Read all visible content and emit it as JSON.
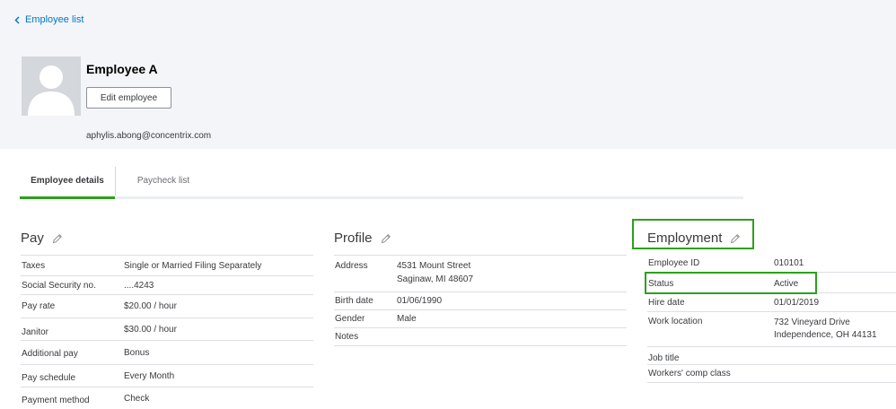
{
  "nav": {
    "back_label": "Employee list"
  },
  "employee": {
    "name": "Employee A",
    "edit_label": "Edit employee",
    "email": "aphylis.abong@concentrix.com"
  },
  "tabs": [
    {
      "label": "Employee details",
      "active": true
    },
    {
      "label": "Paycheck list",
      "active": false
    }
  ],
  "pay": {
    "title": "Pay",
    "rows": [
      {
        "label": "Taxes",
        "value": "Single or Married Filing Separately"
      },
      {
        "label": "Social Security no.",
        "value": "....4243"
      },
      {
        "label": "Pay rate",
        "value": "$20.00 / hour"
      },
      {
        "label": "Janitor",
        "value": "$30.00 / hour"
      },
      {
        "label": "Additional pay",
        "value": "Bonus"
      },
      {
        "label": "Pay schedule",
        "value": "Every Month"
      },
      {
        "label": "Payment method",
        "value": "Check"
      }
    ]
  },
  "profile": {
    "title": "Profile",
    "rows": [
      {
        "label": "Address",
        "value_line1": "4531 Mount Street",
        "value_line2": "Saginaw, MI 48607"
      },
      {
        "label": "Birth date",
        "value": "01/06/1990"
      },
      {
        "label": "Gender",
        "value": "Male"
      },
      {
        "label": "Notes",
        "value": ""
      }
    ]
  },
  "employment": {
    "title": "Employment",
    "rows": [
      {
        "label": "Employee ID",
        "value": "010101"
      },
      {
        "label": "Status",
        "value": "Active"
      },
      {
        "label": "Hire date",
        "value": "01/01/2019"
      },
      {
        "label": "Work location",
        "value_line1": "732 Vineyard Drive",
        "value_line2": "Independence, OH 44131"
      },
      {
        "label": "Job title",
        "value": ""
      },
      {
        "label": "Workers' comp class",
        "value": ""
      }
    ]
  },
  "colors": {
    "header_bg": "#f4f5f8",
    "link": "#0077c5",
    "highlight": "#2ca01c",
    "tab_active": "#2ca01c"
  },
  "icons": [
    "chevron-left-icon",
    "avatar-placeholder-icon",
    "pencil-icon"
  ]
}
